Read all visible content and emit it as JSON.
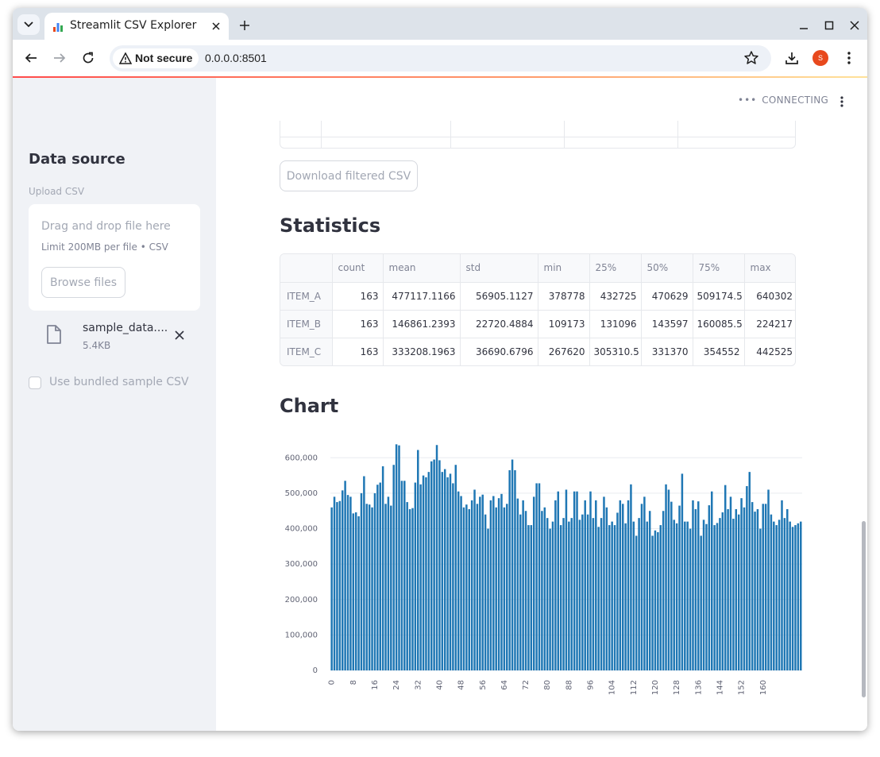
{
  "browser": {
    "tab_title": "Streamlit CSV Explorer",
    "security_label": "Not secure",
    "url": "0.0.0.0:8501",
    "profile_initial": "S",
    "icons": [
      "tab-search-icon",
      "chart-favicon-icon",
      "close-icon",
      "plus-icon",
      "minimize-icon",
      "maximize-icon",
      "window-close-icon",
      "back-arrow-icon",
      "forward-arrow-icon",
      "reload-icon",
      "warning-icon",
      "star-icon",
      "download-icon",
      "kebab-menu-icon"
    ]
  },
  "sidebar": {
    "header": "Data source",
    "upload_label": "Upload CSV",
    "dropzone_title": "Drag and drop file here",
    "dropzone_limit": "Limit 200MB per file • CSV",
    "browse_label": "Browse files",
    "file": {
      "name": "sample_data....",
      "size": "5.4KB"
    },
    "checkbox_label": "Use bundled sample CSV",
    "checkbox_checked": false
  },
  "main": {
    "status": "CONNECTING",
    "download_label": "Download filtered CSV",
    "statistics_title": "Statistics",
    "chart_title": "Chart",
    "stats": {
      "columns": [
        "",
        "count",
        "mean",
        "std",
        "min",
        "25%",
        "50%",
        "75%",
        "max"
      ],
      "rows": [
        [
          "ITEM_A",
          "163",
          "477117.1166",
          "56905.1127",
          "378778",
          "432725",
          "470629",
          "509174.5",
          "640302"
        ],
        [
          "ITEM_B",
          "163",
          "146861.2393",
          "22720.4884",
          "109173",
          "131096",
          "143597",
          "160085.5",
          "224217"
        ],
        [
          "ITEM_C",
          "163",
          "333208.1963",
          "36690.6796",
          "267620",
          "305310.5",
          "331370",
          "354552",
          "442525"
        ]
      ]
    }
  },
  "chart_data": {
    "type": "bar",
    "color": "#1f77b4",
    "ylim": [
      0,
      650000
    ],
    "yticks": [
      0,
      100000,
      200000,
      300000,
      400000,
      500000,
      600000
    ],
    "ytick_labels": [
      "0",
      "100,000",
      "200,000",
      "300,000",
      "400,000",
      "500,000",
      "600,000"
    ],
    "xticks": [
      0,
      8,
      16,
      24,
      32,
      40,
      48,
      56,
      64,
      72,
      80,
      88,
      96,
      104,
      112,
      120,
      128,
      136,
      144,
      152,
      160
    ],
    "grid": true,
    "x_start": 0,
    "values": [
      460000,
      490000,
      475000,
      478000,
      508000,
      535000,
      495000,
      490000,
      443000,
      446000,
      435000,
      500000,
      548000,
      470000,
      468000,
      460000,
      500000,
      524000,
      530000,
      576000,
      470000,
      490000,
      465000,
      580000,
      638000,
      635000,
      535000,
      535000,
      475000,
      455000,
      458000,
      530000,
      622000,
      525000,
      550000,
      545000,
      560000,
      590000,
      595000,
      636000,
      593000,
      560000,
      568000,
      545000,
      555000,
      528000,
      580000,
      505000,
      492000,
      460000,
      468000,
      455000,
      480000,
      510000,
      470000,
      490000,
      496000,
      440000,
      400000,
      480000,
      492000,
      460000,
      486000,
      498000,
      460000,
      470000,
      565000,
      595000,
      565000,
      485000,
      440000,
      480000,
      450000,
      410000,
      410000,
      490000,
      528000,
      528000,
      450000,
      460000,
      430000,
      400000,
      420000,
      480000,
      505000,
      410000,
      430000,
      510000,
      420000,
      430000,
      505000,
      505000,
      425000,
      440000,
      480000,
      440000,
      505000,
      430000,
      480000,
      405000,
      430000,
      490000,
      460000,
      410000,
      420000,
      410000,
      445000,
      480000,
      470000,
      415000,
      480000,
      525000,
      420000,
      380000,
      430000,
      470000,
      490000,
      420000,
      450000,
      380000,
      395000,
      390000,
      410000,
      450000,
      525000,
      510000,
      476000,
      425000,
      415000,
      465000,
      555000,
      420000,
      420000,
      400000,
      480000,
      455000,
      477000,
      380000,
      425000,
      413000,
      466000,
      505000,
      410000,
      416000,
      430000,
      446000,
      523000,
      455000,
      490000,
      428000,
      455000,
      440000,
      486000,
      460000,
      520000,
      560000,
      475000,
      448000,
      455000,
      400000,
      470000,
      470000,
      510000,
      440000,
      420000,
      410000,
      425000,
      480000,
      430000,
      455000,
      420000,
      405000,
      410000,
      415000,
      420000
    ]
  }
}
